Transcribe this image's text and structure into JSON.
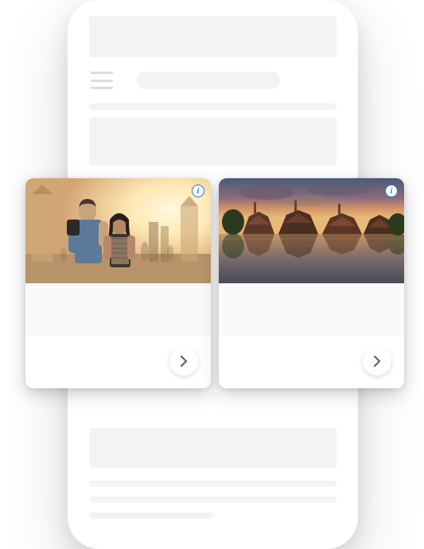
{
  "cards": [
    {
      "image_alt": "couple-at-temple",
      "info_label": "i",
      "arrow_label": "next"
    },
    {
      "image_alt": "temple-sunset-reflection",
      "info_label": "i",
      "arrow_label": "next"
    }
  ],
  "colors": {
    "info_blue": "#1a73e8",
    "skeleton": "#f1f3f4"
  }
}
